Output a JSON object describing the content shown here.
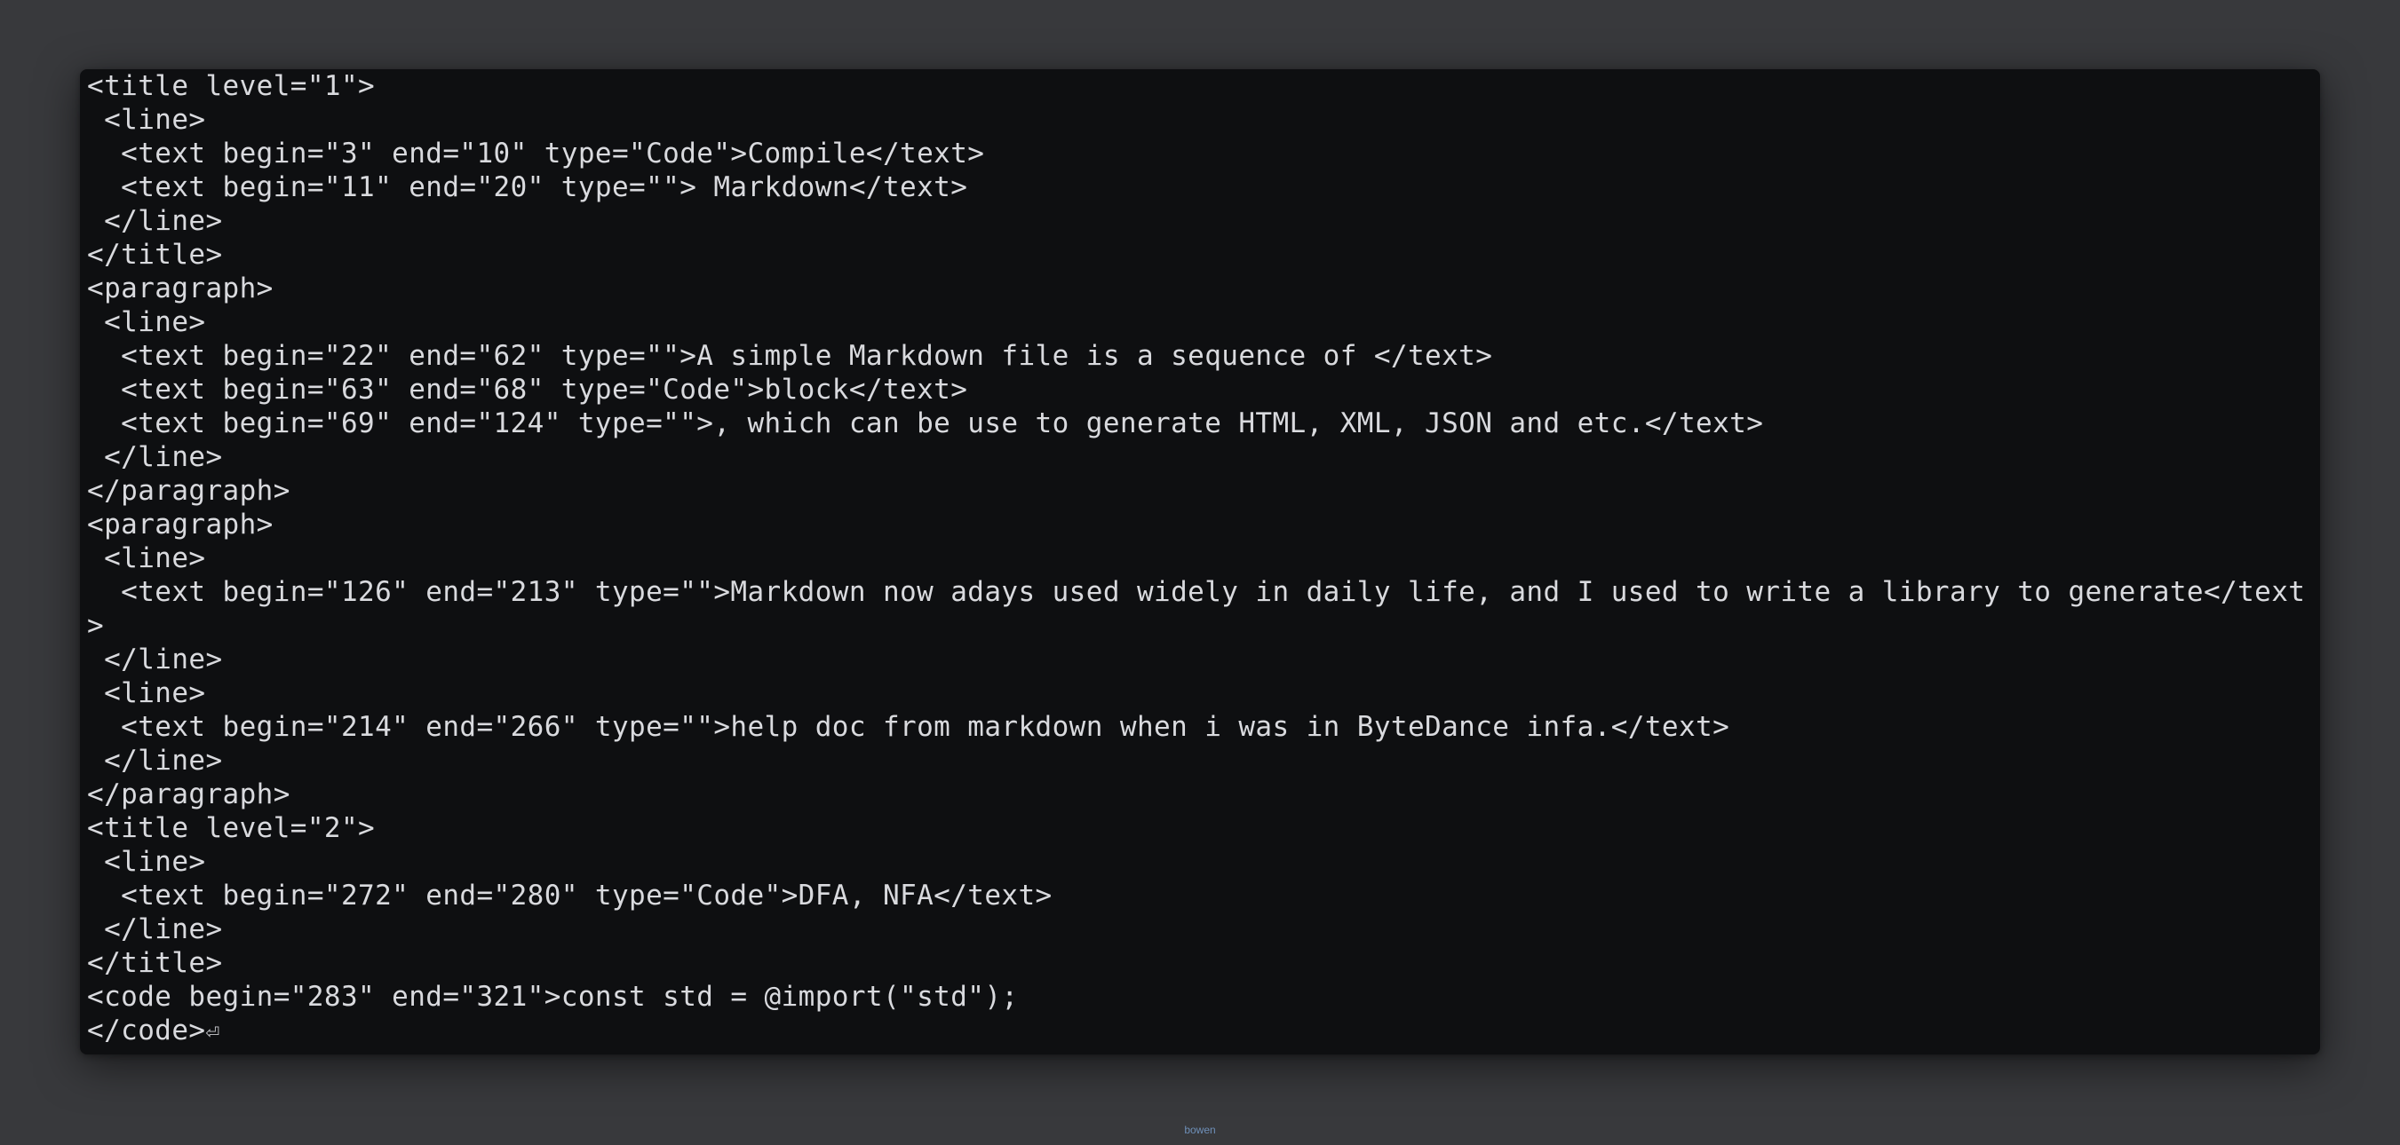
{
  "terminal": {
    "lines": [
      "<title level=\"1\">",
      " <line>",
      "  <text begin=\"3\" end=\"10\" type=\"Code\">Compile</text>",
      "  <text begin=\"11\" end=\"20\" type=\"\"> Markdown</text>",
      " </line>",
      "</title>",
      "<paragraph>",
      " <line>",
      "  <text begin=\"22\" end=\"62\" type=\"\">A simple Markdown file is a sequence of </text>",
      "  <text begin=\"63\" end=\"68\" type=\"Code\">block</text>",
      "  <text begin=\"69\" end=\"124\" type=\"\">, which can be use to generate HTML, XML, JSON and etc.</text>",
      " </line>",
      "</paragraph>",
      "<paragraph>",
      " <line>",
      "  <text begin=\"126\" end=\"213\" type=\"\">Markdown now adays used widely in daily life, and I used to write a library to generate</text",
      ">",
      " </line>",
      " <line>",
      "  <text begin=\"214\" end=\"266\" type=\"\">help doc from markdown when i was in ByteDance infa.</text>",
      " </line>",
      "</paragraph>",
      "<title level=\"2\">",
      " <line>",
      "  <text begin=\"272\" end=\"280\" type=\"Code\">DFA, NFA</text>",
      " </line>",
      "</title>",
      "<code begin=\"283\" end=\"321\">const std = @import(\"std\");",
      "</code>"
    ],
    "end_mark": "⏎"
  },
  "footer": {
    "credit": "bowen"
  }
}
